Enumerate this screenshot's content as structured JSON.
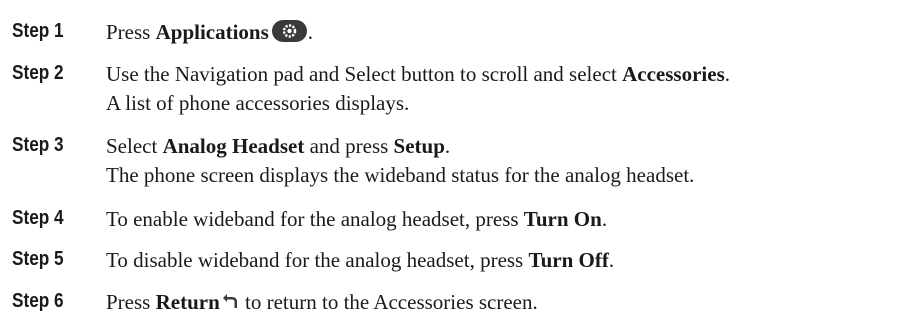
{
  "steps": [
    {
      "label": "Step 1",
      "lines": [
        {
          "pre": "Press ",
          "bold": "Applications",
          "icon": "applications-gear-icon",
          "post": "."
        }
      ]
    },
    {
      "label": "Step 2",
      "lines": [
        {
          "pre": "Use the Navigation pad and Select button to scroll and select ",
          "bold": "Accessories",
          "post": "."
        },
        {
          "text": "A list of phone accessories displays."
        }
      ]
    },
    {
      "label": "Step 3",
      "lines": [
        {
          "pre": "Select ",
          "bold": "Analog Headset",
          "mid": " and press ",
          "bold2": "Setup",
          "post": "."
        },
        {
          "text": "The phone screen displays the wideband status for the analog headset."
        }
      ]
    },
    {
      "label": "Step 4",
      "lines": [
        {
          "pre": "To enable wideband for the analog headset, press ",
          "bold": "Turn On",
          "post": "."
        }
      ]
    },
    {
      "label": "Step 5",
      "lines": [
        {
          "pre": "To disable wideband for the analog headset, press ",
          "bold": "Turn Off",
          "post": "."
        }
      ]
    },
    {
      "label": "Step 6",
      "lines": [
        {
          "pre": "Press ",
          "bold": "Return",
          "icon": "return-arrow-icon",
          "post": " to return to the Accessories screen."
        }
      ]
    }
  ],
  "colors": {
    "text": "#1a1a1a",
    "icon_fill": "#3a3a3a"
  }
}
